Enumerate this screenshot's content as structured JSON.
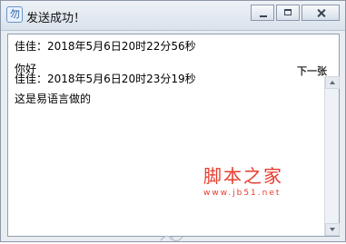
{
  "window": {
    "title": "发送成功！",
    "app_icon_glyph": "勿"
  },
  "messages": [
    {
      "text": "佳佳：2018年5月6日20时22分56秒"
    },
    {
      "text": "你好"
    },
    {
      "text": "佳佳：2018年5月6日20时23分19秒"
    },
    {
      "text": "这是易语言做的"
    }
  ],
  "navigation": {
    "next_page": "下一张"
  },
  "watermark": {
    "logo": "脚本之家",
    "url": "www.jb51.net",
    "color": "#e83b2e"
  }
}
